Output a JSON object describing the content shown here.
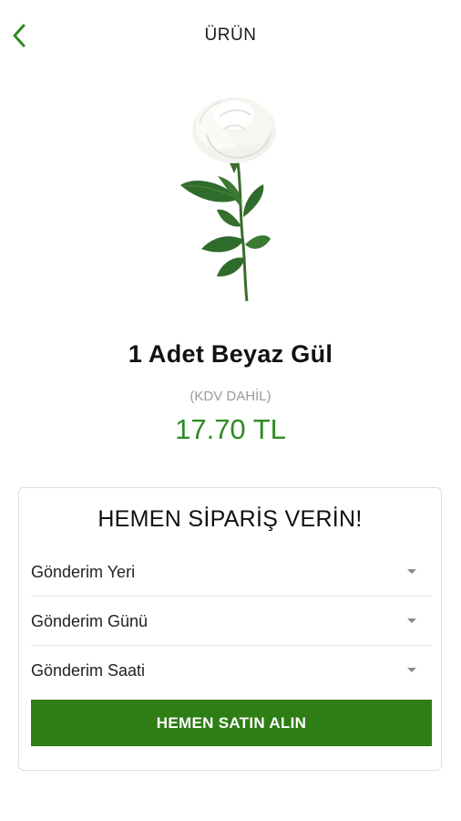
{
  "header": {
    "title": "ÜRÜN",
    "back_icon": "chevron-left-icon"
  },
  "product": {
    "name": "1 Adet Beyaz Gül",
    "tax_note": "(KDV DAHİL)",
    "price": "17.70 TL",
    "image": "white-rose-image"
  },
  "order": {
    "title": "HEMEN SİPARİŞ VERİN!",
    "fields": [
      {
        "label": "Gönderim Yeri"
      },
      {
        "label": "Gönderim Günü"
      },
      {
        "label": "Gönderim Saati"
      }
    ],
    "buy_label": "HEMEN SATIN ALIN"
  },
  "colors": {
    "accent": "#2e7d15",
    "price": "#2e8b22",
    "muted": "#9a9a9a"
  }
}
